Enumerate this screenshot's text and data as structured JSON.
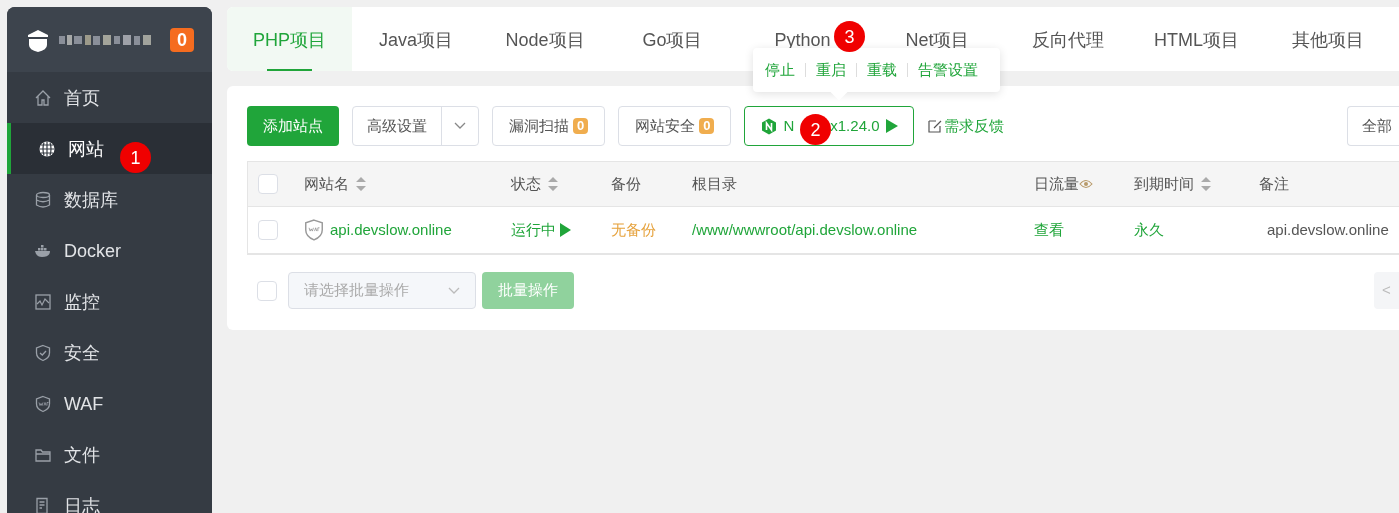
{
  "sidebar": {
    "badge": "0",
    "items": [
      {
        "label": "首页",
        "selected": false
      },
      {
        "label": "网站",
        "selected": true
      },
      {
        "label": "数据库",
        "selected": false
      },
      {
        "label": "Docker",
        "selected": false
      },
      {
        "label": "监控",
        "selected": false
      },
      {
        "label": "安全",
        "selected": false
      },
      {
        "label": "WAF",
        "selected": false
      },
      {
        "label": "文件",
        "selected": false
      },
      {
        "label": "日志",
        "selected": false
      }
    ]
  },
  "tabs": [
    {
      "label": "PHP项目",
      "selected": true
    },
    {
      "label": "Java项目",
      "selected": false
    },
    {
      "label": "Node项目",
      "selected": false
    },
    {
      "label": "Go项目",
      "selected": false
    },
    {
      "label": "Python",
      "selected": false
    },
    {
      "label": "Net项目",
      "selected": false
    },
    {
      "label": "反向代理",
      "selected": false
    },
    {
      "label": "HTML项目",
      "selected": false
    },
    {
      "label": "其他项目",
      "selected": false
    }
  ],
  "popover": {
    "items": [
      "停止",
      "重启",
      "重载",
      "告警设置"
    ]
  },
  "toolbar": {
    "add": "添加站点",
    "advanced": "高级设置",
    "scan": {
      "label": "漏洞扫描",
      "count": "0"
    },
    "security": {
      "label": "网站安全",
      "count": "0"
    },
    "nginx_start": "N",
    "nginx_end": "x1.24.0",
    "feedback": "需求反馈",
    "category": "全部"
  },
  "table": {
    "header_checked": false,
    "columns": [
      {
        "label": "网站名",
        "sortable": true
      },
      {
        "label": "状态",
        "sortable": true
      },
      {
        "label": "备份",
        "sortable": false
      },
      {
        "label": "根目录",
        "sortable": false
      },
      {
        "label": "日流量",
        "sortable": false
      },
      {
        "label": "到期时间",
        "sortable": true
      },
      {
        "label": "备注",
        "sortable": false
      }
    ],
    "rows": [
      {
        "checked": false,
        "name": "api.devslow.online",
        "status": "运行中",
        "backup": "无备份",
        "root": "/www/wwwroot/api.devslow.online",
        "traffic": "查看",
        "expiry": "永久",
        "remark": "api.devslow.online"
      }
    ]
  },
  "batch": {
    "checked": false,
    "placeholder": "请选择批量操作",
    "button": "批量操作",
    "pager": "<"
  },
  "annotations": [
    {
      "kind": "sidebar",
      "label": "1"
    },
    {
      "kind": "nginx",
      "label": "2"
    },
    {
      "kind": "popover",
      "label": "3"
    }
  ]
}
